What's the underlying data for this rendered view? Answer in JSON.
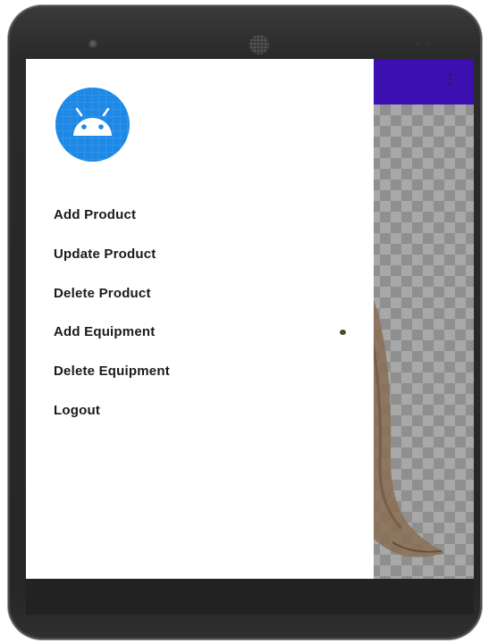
{
  "device": {
    "frame_color": "#2a2a2a",
    "icons": [
      "camera-icon",
      "speaker-grille-icon"
    ]
  },
  "app_bar": {
    "color": "#3b0fb0",
    "overflow_icon": "more-vertical-icon"
  },
  "drawer": {
    "header_icon": "android-robot-icon",
    "header_icon_color": "#1e88e5",
    "items": [
      {
        "label": "Add Product"
      },
      {
        "label": "Update Product"
      },
      {
        "label": "Delete Product"
      },
      {
        "label": "Add Equipment"
      },
      {
        "label": "Delete Equipment"
      },
      {
        "label": "Logout"
      }
    ]
  }
}
